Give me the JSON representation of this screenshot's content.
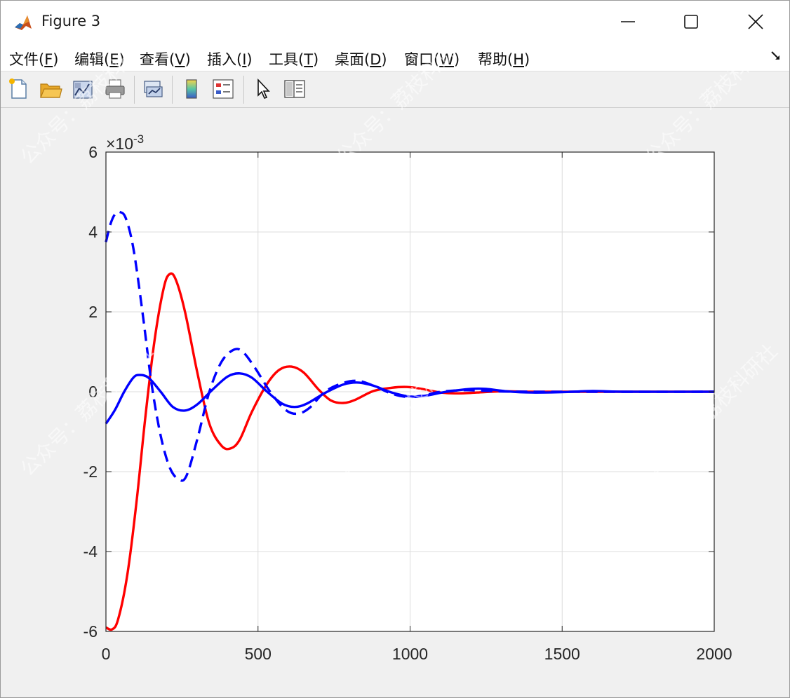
{
  "window": {
    "title": "Figure 3",
    "controls": {
      "minimize": "minimize",
      "maximize": "maximize",
      "close": "close"
    }
  },
  "menu": {
    "items": [
      {
        "label": "文件(",
        "key": "F",
        "suffix": ")"
      },
      {
        "label": "编辑(",
        "key": "E",
        "suffix": ")"
      },
      {
        "label": "查看(",
        "key": "V",
        "suffix": ")"
      },
      {
        "label": "插入(",
        "key": "I",
        "suffix": ")"
      },
      {
        "label": "工具(",
        "key": "T",
        "suffix": ")"
      },
      {
        "label": "桌面(",
        "key": "D",
        "suffix": ")"
      },
      {
        "label": "窗口(",
        "key": "W",
        "suffix": ")"
      },
      {
        "label": "帮助(",
        "key": "H",
        "suffix": ")"
      }
    ]
  },
  "toolbar": {
    "icons": [
      "new-figure-icon",
      "open-file-icon",
      "link-plot-icon",
      "print-icon",
      "link-axes-icon",
      "colorbar-icon",
      "legend-icon",
      "pointer-icon",
      "property-inspector-icon"
    ]
  },
  "watermark": "公众号：荔枝科研社",
  "chart_data": {
    "type": "line",
    "xlim": [
      0,
      2000
    ],
    "ylim": [
      -6,
      6
    ],
    "x_ticks": [
      "0",
      "500",
      "1000",
      "1500",
      "2000"
    ],
    "y_ticks": [
      "-6",
      "-4",
      "-2",
      "0",
      "2",
      "4",
      "6"
    ],
    "y_multiplier": "×10",
    "y_exponent": "-3",
    "grid": true,
    "series": [
      {
        "color": "#ff0000",
        "style": "solid",
        "points": [
          [
            0,
            -5.9
          ],
          [
            20,
            -5.95
          ],
          [
            40,
            -5.7
          ],
          [
            70,
            -4.6
          ],
          [
            100,
            -2.8
          ],
          [
            130,
            -0.6
          ],
          [
            160,
            1.3
          ],
          [
            190,
            2.6
          ],
          [
            210,
            2.95
          ],
          [
            230,
            2.8
          ],
          [
            260,
            2.0
          ],
          [
            300,
            0.5
          ],
          [
            340,
            -0.8
          ],
          [
            380,
            -1.35
          ],
          [
            410,
            -1.42
          ],
          [
            440,
            -1.2
          ],
          [
            480,
            -0.5
          ],
          [
            530,
            0.2
          ],
          [
            570,
            0.55
          ],
          [
            610,
            0.63
          ],
          [
            650,
            0.48
          ],
          [
            700,
            0.05
          ],
          [
            740,
            -0.22
          ],
          [
            780,
            -0.28
          ],
          [
            820,
            -0.2
          ],
          [
            880,
            0.02
          ],
          [
            940,
            0.1
          ],
          [
            990,
            0.12
          ],
          [
            1040,
            0.07
          ],
          [
            1100,
            -0.02
          ],
          [
            1160,
            -0.04
          ],
          [
            1220,
            -0.02
          ],
          [
            1300,
            0.01
          ],
          [
            1400,
            0.0
          ],
          [
            1600,
            0.0
          ],
          [
            2000,
            0.0
          ]
        ]
      },
      {
        "color": "#0000ff",
        "style": "dashed",
        "points": [
          [
            0,
            3.75
          ],
          [
            15,
            4.2
          ],
          [
            30,
            4.45
          ],
          [
            45,
            4.5
          ],
          [
            65,
            4.35
          ],
          [
            90,
            3.6
          ],
          [
            120,
            2.0
          ],
          [
            150,
            0.2
          ],
          [
            180,
            -1.1
          ],
          [
            210,
            -1.9
          ],
          [
            240,
            -2.2
          ],
          [
            265,
            -2.1
          ],
          [
            300,
            -1.2
          ],
          [
            340,
            0.0
          ],
          [
            380,
            0.75
          ],
          [
            420,
            1.05
          ],
          [
            450,
            1.0
          ],
          [
            490,
            0.6
          ],
          [
            540,
            0.0
          ],
          [
            590,
            -0.45
          ],
          [
            630,
            -0.55
          ],
          [
            670,
            -0.4
          ],
          [
            720,
            0.0
          ],
          [
            780,
            0.22
          ],
          [
            830,
            0.27
          ],
          [
            880,
            0.15
          ],
          [
            940,
            -0.05
          ],
          [
            990,
            -0.13
          ],
          [
            1040,
            -0.1
          ],
          [
            1100,
            0.0
          ],
          [
            1180,
            0.04
          ],
          [
            1260,
            0.02
          ],
          [
            1400,
            0.0
          ],
          [
            2000,
            0.0
          ]
        ]
      },
      {
        "color": "#0000ff",
        "style": "solid",
        "points": [
          [
            0,
            -0.8
          ],
          [
            30,
            -0.45
          ],
          [
            60,
            0.0
          ],
          [
            90,
            0.35
          ],
          [
            110,
            0.42
          ],
          [
            140,
            0.35
          ],
          [
            180,
            0.0
          ],
          [
            220,
            -0.38
          ],
          [
            260,
            -0.47
          ],
          [
            300,
            -0.32
          ],
          [
            350,
            0.05
          ],
          [
            400,
            0.38
          ],
          [
            440,
            0.46
          ],
          [
            480,
            0.35
          ],
          [
            530,
            0.0
          ],
          [
            580,
            -0.3
          ],
          [
            620,
            -0.38
          ],
          [
            660,
            -0.3
          ],
          [
            720,
            -0.03
          ],
          [
            780,
            0.18
          ],
          [
            830,
            0.23
          ],
          [
            880,
            0.15
          ],
          [
            940,
            -0.02
          ],
          [
            1000,
            -0.12
          ],
          [
            1050,
            -0.1
          ],
          [
            1120,
            0.0
          ],
          [
            1200,
            0.07
          ],
          [
            1250,
            0.07
          ],
          [
            1320,
            0.01
          ],
          [
            1400,
            -0.02
          ],
          [
            1500,
            -0.01
          ],
          [
            1600,
            0.02
          ],
          [
            1700,
            0.0
          ],
          [
            2000,
            0.0
          ]
        ]
      }
    ]
  }
}
